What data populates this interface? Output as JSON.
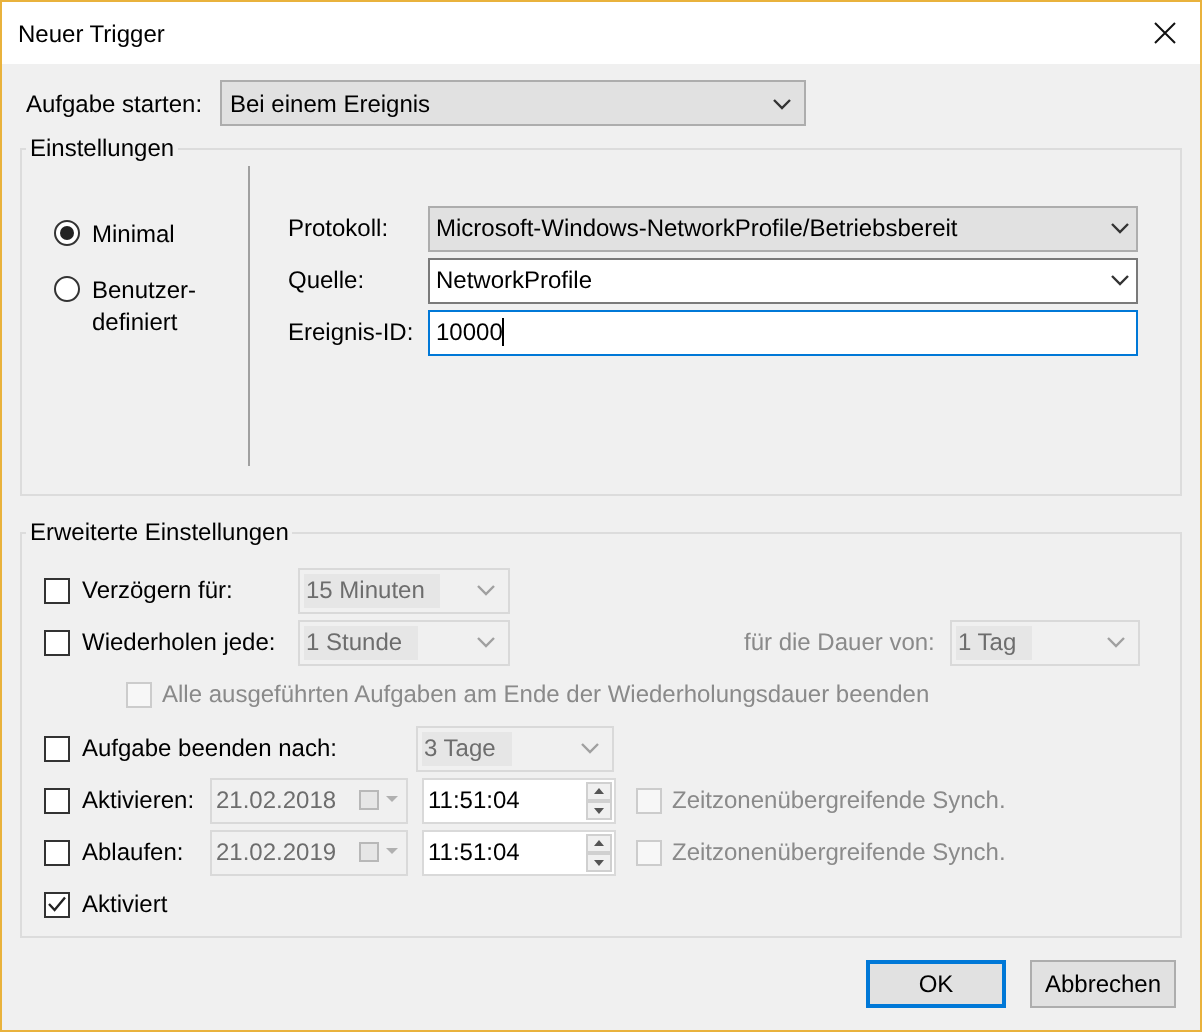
{
  "window": {
    "title": "Neuer Trigger"
  },
  "start": {
    "label": "Aufgabe starten:",
    "value": "Bei einem Ereignis"
  },
  "settings": {
    "title": "Einstellungen",
    "modes": [
      {
        "label": "Minimal",
        "selected": true
      },
      {
        "label": "Benutzer-definiert",
        "selected": false
      }
    ],
    "fields": [
      {
        "kind": "select",
        "label": "Protokoll:",
        "value": "Microsoft-Windows-NetworkProfile/Betriebsbereit"
      },
      {
        "kind": "combo",
        "label": "Quelle:",
        "value": "NetworkProfile"
      },
      {
        "kind": "text",
        "label": "Ereignis-ID:",
        "value": "10000",
        "focused": true
      }
    ]
  },
  "advanced": {
    "title": "Erweiterte Einstellungen",
    "rows": [
      {
        "kind": "duration",
        "label": "Verzögern für:",
        "checked": false,
        "value": "15 Minuten"
      },
      {
        "kind": "repeat",
        "label": "Wiederholen jede:",
        "checked": false,
        "value": "1 Stunde",
        "duration_label": "für die Dauer von:",
        "duration_value": "1 Tag"
      },
      {
        "kind": "sub_option",
        "label": "Alle ausgeführten Aufgaben am Ende der Wiederholungsdauer beenden",
        "checked": false,
        "disabled": true
      },
      {
        "kind": "limit",
        "label": "Aufgabe beenden nach:",
        "checked": false,
        "value": "3 Tage"
      },
      {
        "kind": "datetime",
        "label": "Aktivieren:",
        "checked": false,
        "date": "21.02.2018",
        "time": "11:51:04",
        "sync_label": "Zeitzonenübergreifende Synch.",
        "sync_checked": false
      },
      {
        "kind": "datetime",
        "label": "Ablaufen:",
        "checked": false,
        "date": "21.02.2019",
        "time": "11:51:04",
        "sync_label": "Zeitzonenübergreifende Synch.",
        "sync_checked": false
      },
      {
        "kind": "flag",
        "label": "Aktiviert",
        "checked": true
      }
    ]
  },
  "buttons": [
    {
      "label": "OK",
      "default": true
    },
    {
      "label": "Abbrechen",
      "default": false
    }
  ]
}
